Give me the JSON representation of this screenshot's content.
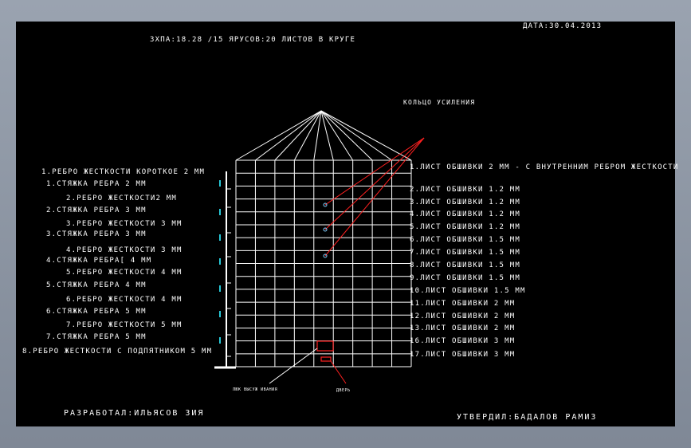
{
  "header": {
    "date": "ДАТА:30.04.2013",
    "title": "ЗХПА:18.28 /15 ЯРУСОВ:20 ЛИСТОВ В КРУГЕ",
    "ring_label": "КОЛЬЦО УСИЛЕНИЯ"
  },
  "left_labels": [
    "1.РЕБРО ЖЕСТКОСТИ КОРОТКОЕ 2 ММ",
    "1.СТЯЖКА РЕБРА 2 ММ",
    "2.РЕБРО ЖЕСТКОСТИ2 ММ",
    "2.СТЯЖКА РЕБРА 3 ММ",
    "3.РЕБРО ЖЕСТКОСТИ 3 ММ",
    "3.СТЯЖКА РЕБРА 3 ММ",
    "4.РЕБРО ЖЕСТКОСТИ 3 ММ",
    "4.СТЯЖКА РЕБРА[ 4 ММ",
    "5.РЕБРО ЖЕСТКОСТИ 4 ММ",
    "5.СТЯЖКА РЕБРА 4 ММ",
    "6.РЕБРО ЖЕСТКОСТИ 4 ММ",
    "6.СТЯЖКА РЕБРА 5 ММ",
    "7.РЕБРО ЖЕСТКОСТИ 5 ММ",
    "7.СТЯЖКА РЕБРА 5 ММ",
    "8.РЕБРО ЖЕСТКОСТИ С ПОДПЯТНИКОМ 5 ММ"
  ],
  "right_labels": [
    "1.ЛИСТ ОБШИВКИ 2 ММ - С ВНУТРЕННИМ РЕБРОМ ЖЕСТКОСТИ",
    "2.ЛИСТ ОБШИВКИ 1.2 ММ",
    "3.ЛИСТ ОБШИВКИ 1.2 ММ",
    "4.ЛИСТ ОБШИВКИ 1.2 ММ",
    "5.ЛИСТ ОБШИВКИ 1.2 ММ",
    "6.ЛИСТ ОБШИВКИ 1.5 ММ",
    "7.ЛИСТ ОБШИВКИ 1.5 ММ",
    "8.ЛИСТ ОБШИВКИ 1.5 ММ",
    "9.ЛИСТ ОБШИВКИ 1.5 ММ",
    "10.ЛИСТ ОБШИВКИ 1.5 ММ",
    "11.ЛИСТ ОБШИВКИ 2 ММ",
    "12.ЛИСТ ОБШИВКИ 2 ММ",
    "13.ЛИСТ ОБШИВКИ 2 ММ",
    "16.ЛИСТ ОБШИВКИ 3 ММ",
    "17.ЛИСТ ОБШИВКИ 3 ММ"
  ],
  "bottom_labels": {
    "hatch": "ЛЮК ВЫСУЖ ИВАНИЯ",
    "door": "ДВЕРЬ"
  },
  "footer": {
    "developer": "РАЗРАБОТАЛ:ИЛЬЯСОВ ЗИЯ",
    "approver": "УТВЕРДИЛ:БАДАЛОВ РАМИЗ"
  },
  "colors": {
    "background": "#000000",
    "lines": "#ffffff",
    "leaders": "#ff2020",
    "stiffener_marks": "#27c6d6"
  }
}
